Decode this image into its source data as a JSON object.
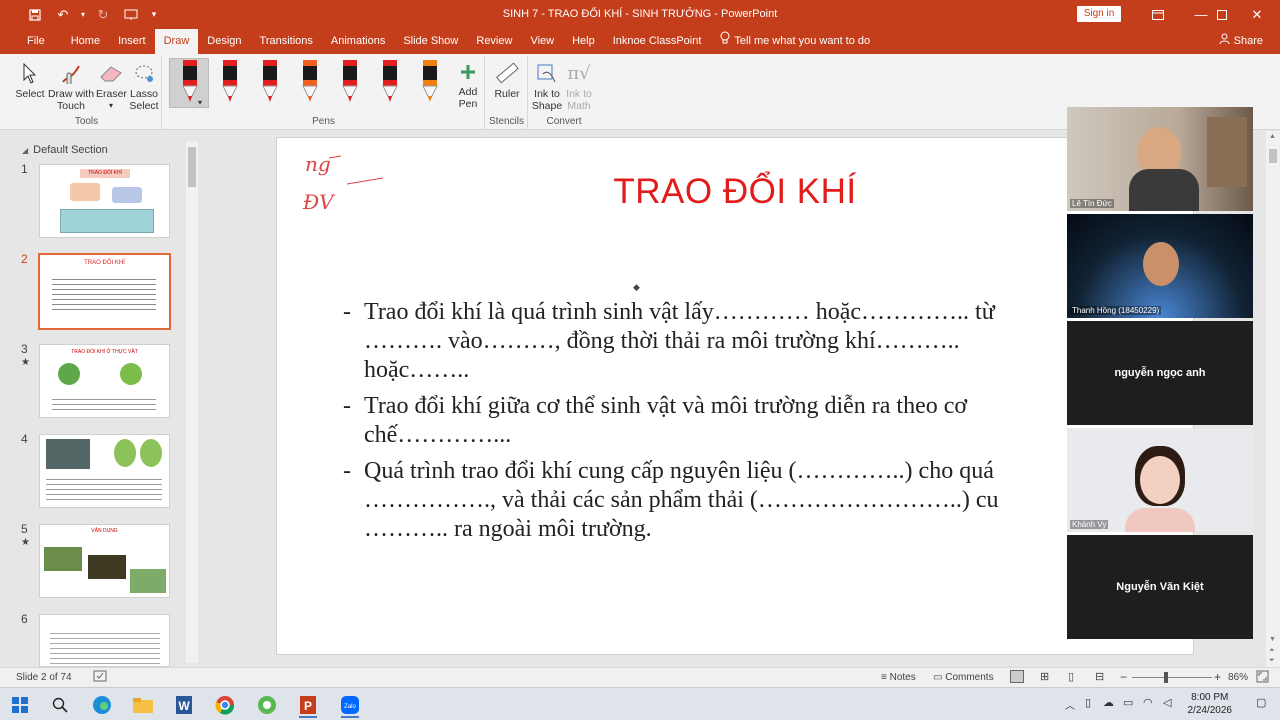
{
  "window": {
    "title": "SINH 7 - TRAO ĐỔI KHÍ - SINH TRƯỞNG  -  PowerPoint",
    "sign_in": "Sign in"
  },
  "tabs": [
    "File",
    "Home",
    "Insert",
    "Draw",
    "Design",
    "Transitions",
    "Animations",
    "Slide Show",
    "Review",
    "View",
    "Help",
    "Inknoe ClassPoint"
  ],
  "active_tab": "Draw",
  "tell_me": "Tell me what you want to do",
  "share": "Share",
  "ribbon": {
    "tools": {
      "label": "Tools",
      "select": "Select",
      "draw_with_touch_1": "Draw with",
      "draw_with_touch_2": "Touch",
      "eraser": "Eraser",
      "lasso_1": "Lasso",
      "lasso_2": "Select"
    },
    "pens": {
      "label": "Pens",
      "colors": [
        "#e02020",
        "#e02020",
        "#e02020",
        "#f06020",
        "#e02020",
        "#e02020",
        "#f08010"
      ]
    },
    "add_pen_1": "Add",
    "add_pen_2": "Pen",
    "stencils": {
      "label": "Stencils",
      "ruler": "Ruler"
    },
    "convert": {
      "label": "Convert",
      "ink_to_shape_1": "Ink to",
      "ink_to_shape_2": "Shape",
      "ink_to_math_1": "Ink to",
      "ink_to_math_2": "Math"
    }
  },
  "left_pane": {
    "section": "Default Section",
    "slides": [
      {
        "num": "1",
        "star": ""
      },
      {
        "num": "2",
        "star": ""
      },
      {
        "num": "3",
        "star": "★"
      },
      {
        "num": "4",
        "star": ""
      },
      {
        "num": "5",
        "star": "★"
      },
      {
        "num": "6",
        "star": ""
      }
    ],
    "thumb1_title": "TRAO ĐỔI KHÍ",
    "thumb2_title": "TRAO ĐỔI KHÍ",
    "thumb3_title": "TRAO ĐỔI KHÍ Ở THỰC VẬT",
    "thumb5_title": "VẬN DỤNG"
  },
  "slide": {
    "title": "TRAO ĐỔI KHÍ",
    "handwriting_1": "ng",
    "handwriting_2": "ĐV",
    "bullet1_l1": "Trao đổi khí là quá trình sinh vật lấy………… hoặc………….. từ",
    "bullet1_l2": "………. vào………, đồng thời thải ra môi trường khí………..",
    "bullet1_l3": "hoặc……..",
    "bullet2_l1": "Trao đổi khí giữa cơ thể sinh vật và môi trường diễn ra theo cơ",
    "bullet2_l2": "chế…………...",
    "bullet3_l1": "Quá trình trao đổi khí cung cấp nguyên liệu (…………..) cho quá",
    "bullet3_l2": "……………., và thải các sản phẩm thải (……………………..) cu",
    "bullet3_l3": "……….. ra ngoài môi trường."
  },
  "participants": [
    {
      "name": "Lê Tín Đức"
    },
    {
      "name": "Thanh Hồng (18450229)"
    },
    {
      "name": "nguyễn ngọc anh"
    },
    {
      "name": "Khánh Vy"
    },
    {
      "name": "Nguyễn Văn Kiệt"
    }
  ],
  "status": {
    "slide_of": "Slide 2 of 74",
    "notes": "Notes",
    "comments": "Comments",
    "zoom": "86%",
    "zoom_level": 0.43
  },
  "taskbar": {
    "time": "8:00 PM",
    "date": "2/24/2026"
  }
}
